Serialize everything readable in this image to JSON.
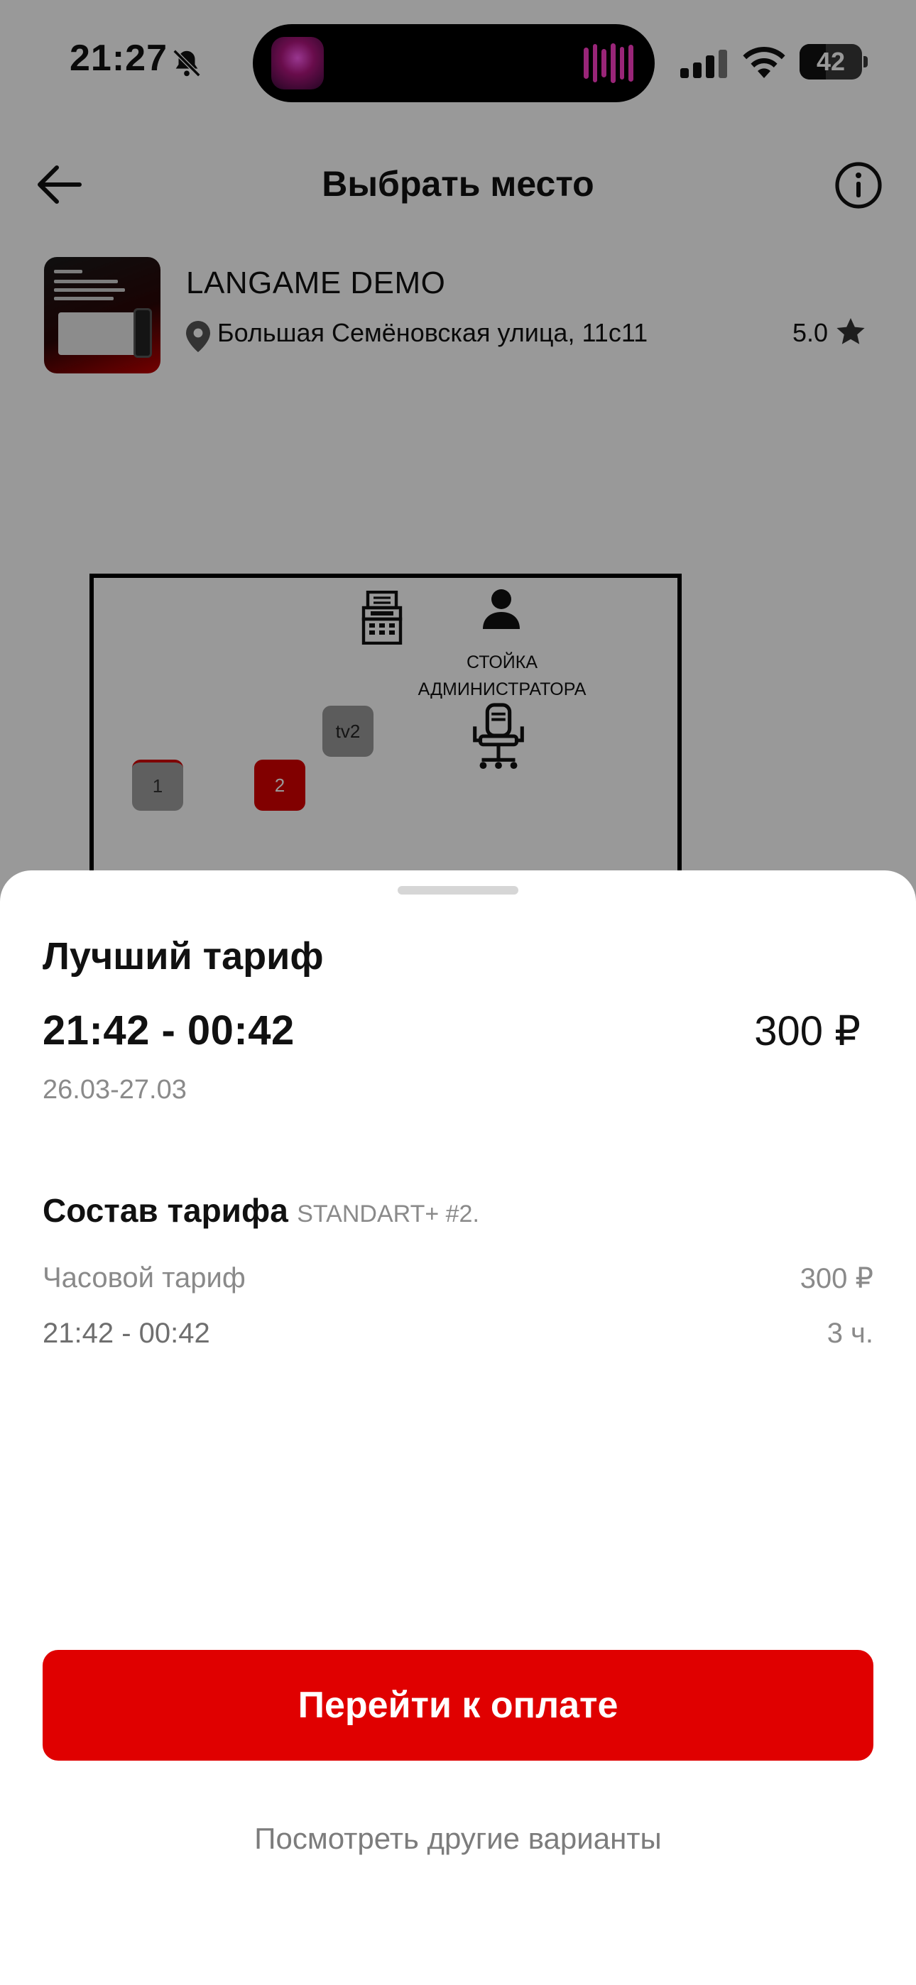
{
  "status_bar": {
    "time": "21:27",
    "battery": "42",
    "battery_level_percent": 42
  },
  "nav": {
    "title": "Выбрать место"
  },
  "club": {
    "name": "LANGAME DEMO",
    "address": "Большая Семёновская улица, 11с11",
    "rating": "5.0"
  },
  "map": {
    "admin_label_line1": "СТОЙКА",
    "admin_label_line2": "АДМИНИСТРАТОРА",
    "seats": [
      {
        "label": "tv2",
        "status": "inactive"
      },
      {
        "label": "1",
        "status": "inactive"
      },
      {
        "label": "2",
        "status": "selected"
      }
    ]
  },
  "sheet": {
    "title": "Лучший тариф",
    "time_range": "21:42 - 00:42",
    "price": "300 ₽",
    "date_range": "26.03-27.03",
    "composition_title": "Состав тарифа",
    "composition_code": "STANDART+ #2.",
    "rows": [
      {
        "label": "Часовой тариф",
        "value": "300 ₽"
      },
      {
        "label": "21:42 - 00:42",
        "value": "3 ч."
      }
    ],
    "pay_button": "Перейти к оплате",
    "other_options": "Посмотреть другие варианты"
  },
  "colors": {
    "accent": "#e00000",
    "seat_selected": "#d80000",
    "muted_text": "#8a8a8a",
    "overlay": "rgba(0,0,0,0.4)"
  },
  "icons": [
    "bell-slash-icon",
    "signal-icon",
    "wifi-icon",
    "battery-icon",
    "back-arrow-icon",
    "info-icon",
    "location-pin-icon",
    "star-icon",
    "cash-register-icon",
    "person-icon",
    "office-chair-icon"
  ]
}
